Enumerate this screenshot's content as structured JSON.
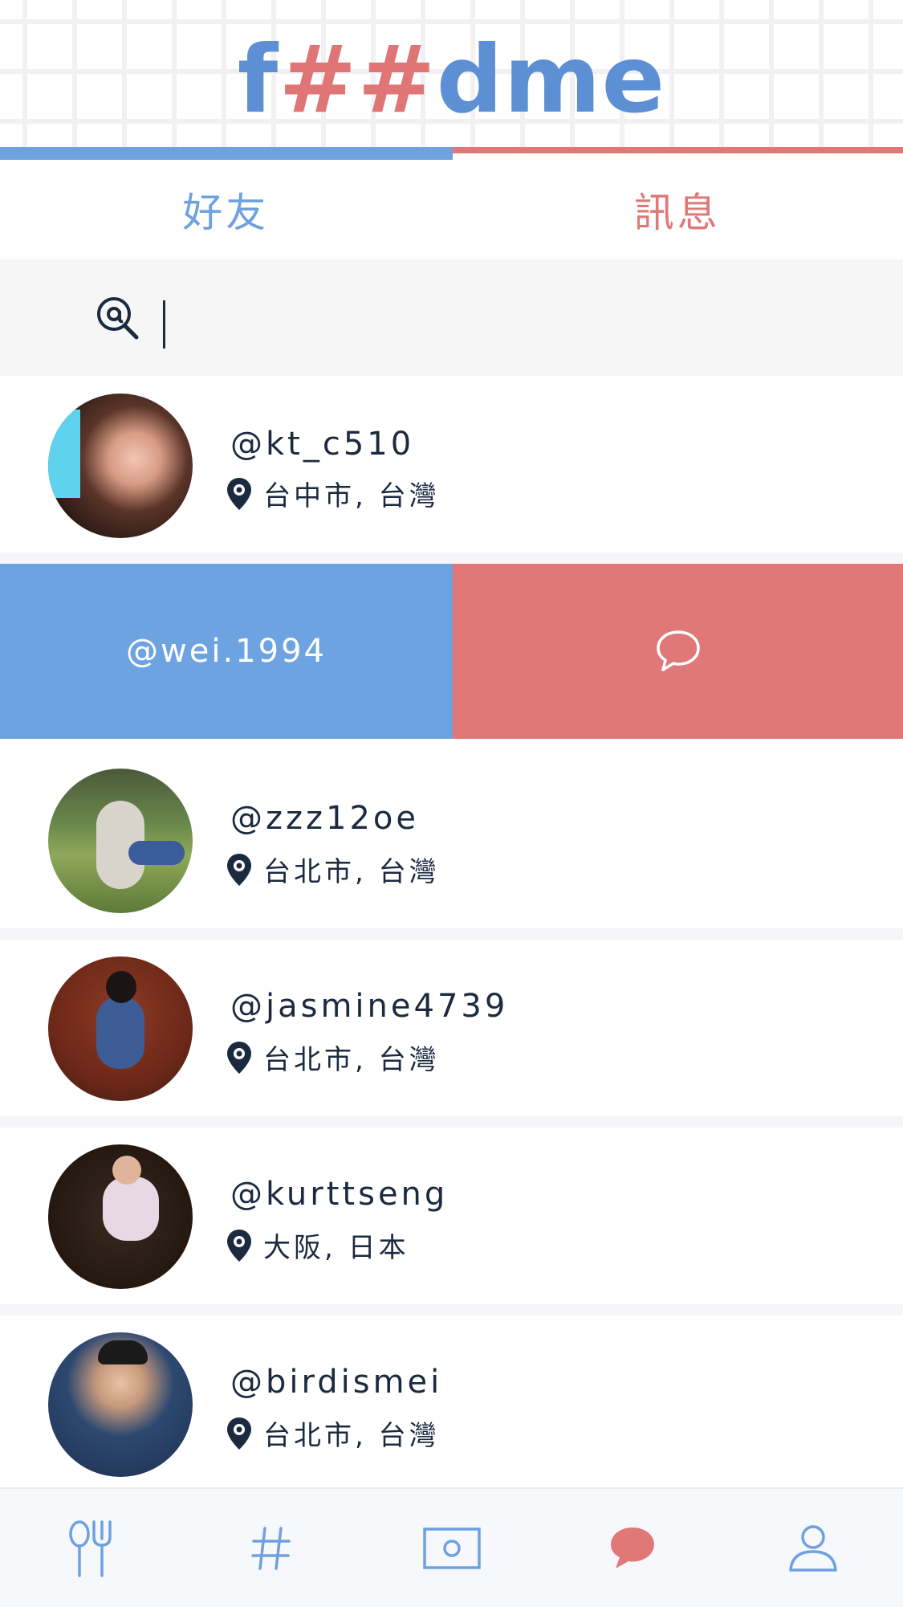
{
  "app": {
    "logo_parts": [
      "f",
      "##",
      "dme"
    ],
    "brand_blue": "#6ea1e0",
    "brand_red": "#e07878"
  },
  "tabs": [
    {
      "label": "好友",
      "active": true
    },
    {
      "label": "訊息",
      "active": false
    }
  ],
  "search": {
    "placeholder": "",
    "value": ""
  },
  "friends": [
    {
      "username": "@kt_c510",
      "location": "台中市, 台灣"
    },
    {
      "username": "@wei.1994",
      "swiped": true
    },
    {
      "username": "@zzz12oe",
      "location": "台北市, 台灣"
    },
    {
      "username": "@jasmine4739",
      "location": "台北市, 台灣"
    },
    {
      "username": "@kurttseng",
      "location": "大阪, 日本"
    },
    {
      "username": "@birdismei",
      "location": "台北市, 台灣"
    }
  ],
  "bottom_nav": [
    {
      "icon": "fork-spoon-icon",
      "active": false
    },
    {
      "icon": "hashtag-icon",
      "active": false
    },
    {
      "icon": "photo-frame-icon",
      "active": false
    },
    {
      "icon": "chat-bubble-icon",
      "active": true
    },
    {
      "icon": "person-icon",
      "active": false
    }
  ]
}
